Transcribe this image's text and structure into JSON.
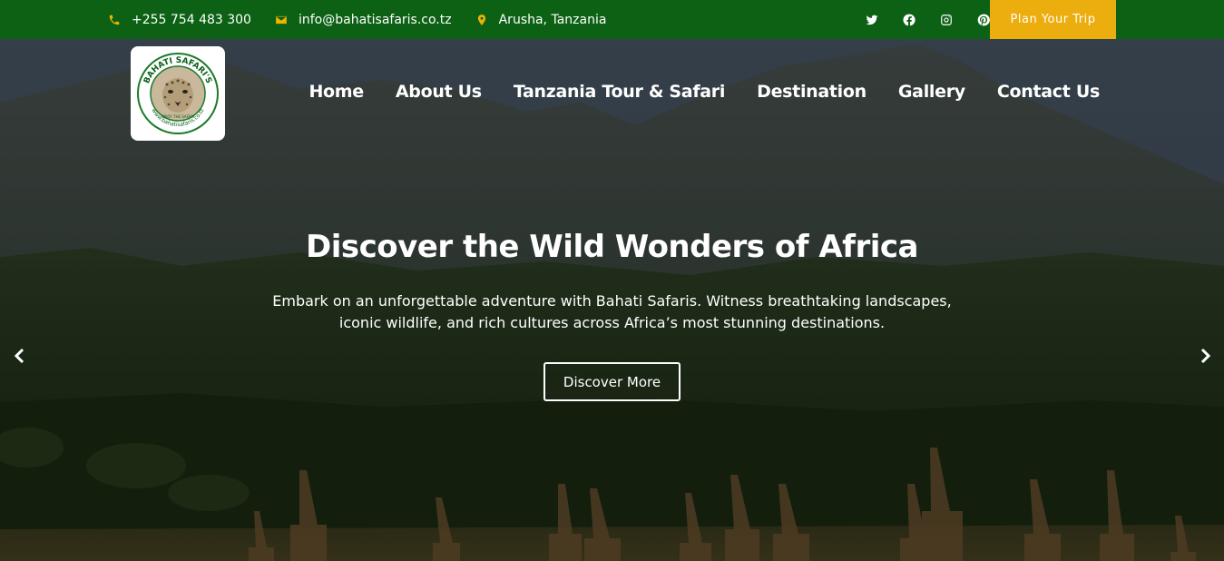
{
  "topbar": {
    "phone": "+255 754 483 300",
    "email": "info@bahatisafaris.co.tz",
    "location": "Arusha, Tanzania",
    "icons": [
      "phone-icon",
      "envelope-icon",
      "map-pin-icon"
    ],
    "socials": [
      "twitter-icon",
      "facebook-icon",
      "instagram-icon",
      "pinterest-icon"
    ],
    "cta_label": "Plan Your Trip",
    "bg_color": "#0c6114",
    "accent_color": "#ecad0e"
  },
  "logo": {
    "text_top": "BAHATI SAFARI'S",
    "text_bottom": "www.bahatisafaris.co.tz",
    "motto": "ENJOY THE SAFARI"
  },
  "nav": {
    "items": [
      "Home",
      "About Us",
      "Tanzania Tour & Safari",
      "Destination",
      "Gallery",
      "Contact Us"
    ]
  },
  "hero": {
    "title": "Discover the Wild Wonders of Africa",
    "subtitle": "Embark on an unforgettable adventure with Bahati Safaris. Witness breathtaking landscapes, iconic wildlife, and rich cultures across Africa’s most stunning destinations.",
    "button_label": "Discover More",
    "prev_icon": "chevron-left-icon",
    "next_icon": "chevron-right-icon"
  }
}
